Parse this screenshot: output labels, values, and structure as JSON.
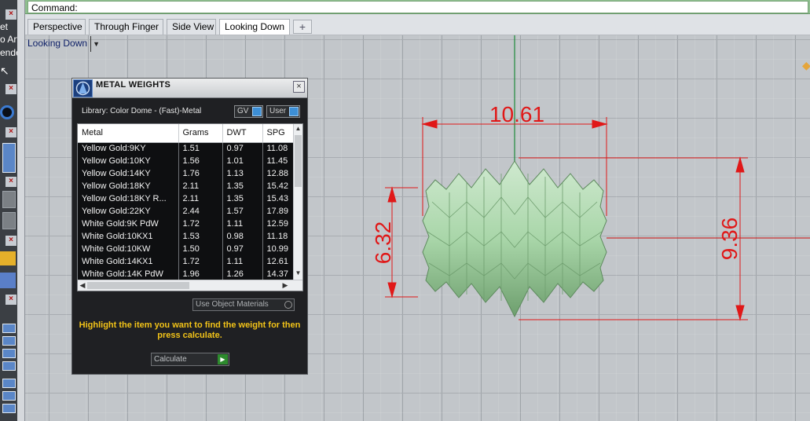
{
  "command_bar": {
    "label": "Command:"
  },
  "tabs": [
    {
      "label": "Perspective",
      "active": false
    },
    {
      "label": "Through Finger",
      "active": false
    },
    {
      "label": "Side View",
      "active": false
    },
    {
      "label": "Looking Down",
      "active": true
    }
  ],
  "tab_add_label": "+",
  "viewport": {
    "view_select": "Looking Down",
    "dimensions": {
      "width": "10.61",
      "height_left": "6.32",
      "height_right": "9.36"
    },
    "model_color": "#a9d6a9",
    "dimension_color": "#e01818"
  },
  "left_toolbar": {
    "labels": [
      "et",
      "o Art",
      "ender"
    ]
  },
  "metal_weights": {
    "title": "METAL WEIGHTS",
    "close_label": "×",
    "library_label": "Library: Color Dome - (Fast)-Metal",
    "gv_label": "GV",
    "user_label": "User",
    "columns": [
      "Metal",
      "Grams",
      "DWT",
      "SPG"
    ],
    "rows": [
      [
        "Yellow Gold:9KY",
        "1.51",
        "0.97",
        "11.08"
      ],
      [
        "Yellow Gold:10KY",
        "1.56",
        "1.01",
        "11.45"
      ],
      [
        "Yellow Gold:14KY",
        "1.76",
        "1.13",
        "12.88"
      ],
      [
        "Yellow Gold:18KY",
        "2.11",
        "1.35",
        "15.42"
      ],
      [
        "Yellow Gold:18KY R...",
        "2.11",
        "1.35",
        "15.43"
      ],
      [
        "Yellow Gold:22KY",
        "2.44",
        "1.57",
        "17.89"
      ],
      [
        "White Gold:9K PdW",
        "1.72",
        "1.11",
        "12.59"
      ],
      [
        "White Gold:10KX1",
        "1.53",
        "0.98",
        "11.18"
      ],
      [
        "White Gold:10KW",
        "1.50",
        "0.97",
        "10.99"
      ],
      [
        "White Gold:14KX1",
        "1.72",
        "1.11",
        "12.61"
      ],
      [
        "White Gold:14K PdW",
        "1.96",
        "1.26",
        "14.37"
      ]
    ],
    "use_object_materials": "Use Object Materials",
    "instruction": "Highlight the item you want to find the weight for then press calculate.",
    "calculate_label": "Calculate"
  }
}
